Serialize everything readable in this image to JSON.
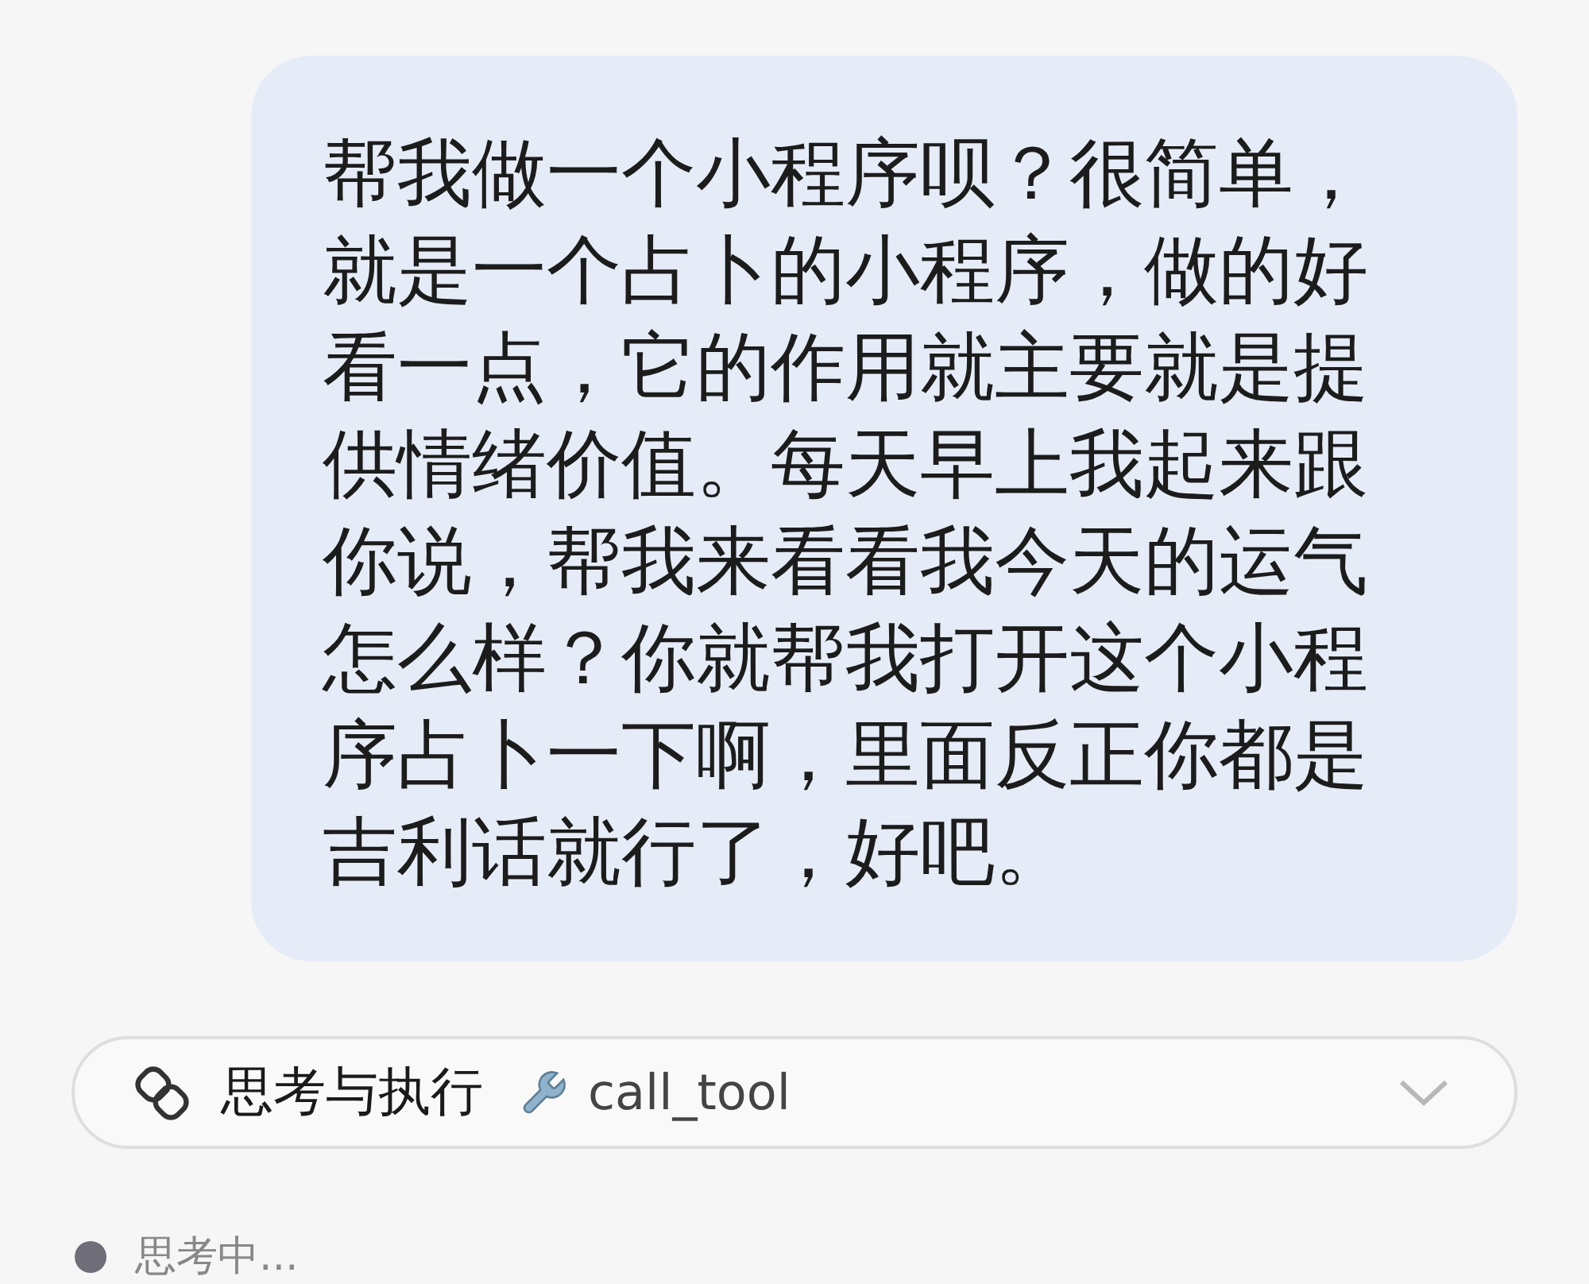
{
  "message": {
    "text": "帮我做一个小程序呗？很简单，就是一个占卜的小程序，做的好看一点，它的作用就主要就是提供情绪价值。每天早上我起来跟你说，帮我来看看我今天的运气怎么样？你就帮我打开这个小程序占卜一下啊，里面反正你都是吉利话就行了，好吧。"
  },
  "process_card": {
    "title": "思考与执行",
    "tool": "call_tool",
    "expanded": false
  },
  "status": {
    "text": "思考中..."
  }
}
